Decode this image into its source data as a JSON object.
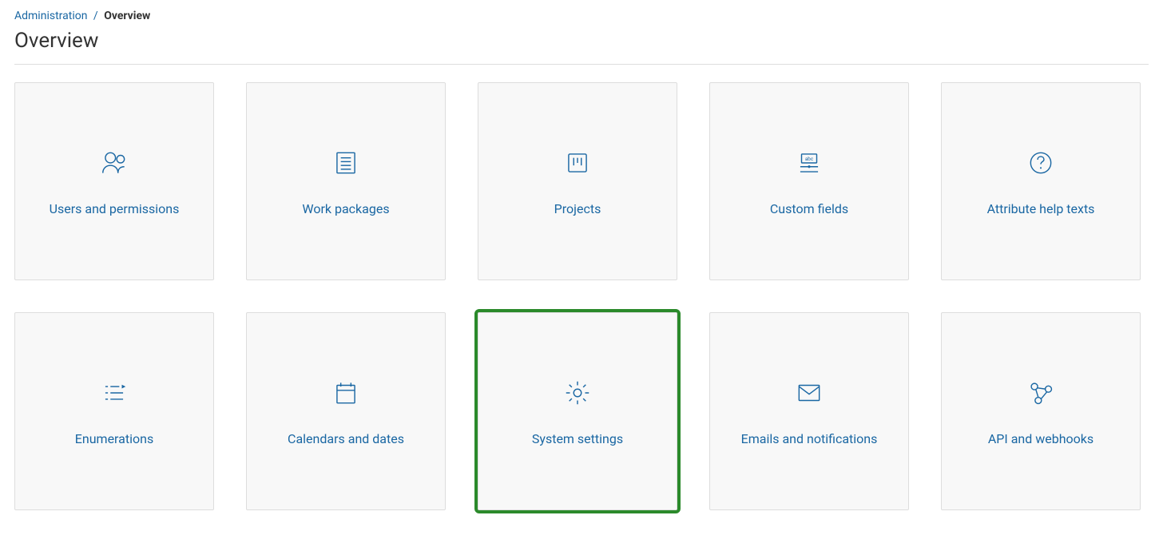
{
  "breadcrumb": {
    "parent": "Administration",
    "separator": "/",
    "current": "Overview"
  },
  "page_title": "Overview",
  "cards": [
    {
      "label": "Users and permissions",
      "icon": "users-icon",
      "highlighted": false
    },
    {
      "label": "Work packages",
      "icon": "document-icon",
      "highlighted": false
    },
    {
      "label": "Projects",
      "icon": "board-icon",
      "highlighted": false
    },
    {
      "label": "Custom fields",
      "icon": "custom-fields-icon",
      "highlighted": false
    },
    {
      "label": "Attribute help texts",
      "icon": "help-icon",
      "highlighted": false
    },
    {
      "label": "Enumerations",
      "icon": "list-icon",
      "highlighted": false
    },
    {
      "label": "Calendars and dates",
      "icon": "calendar-icon",
      "highlighted": false
    },
    {
      "label": "System settings",
      "icon": "gear-icon",
      "highlighted": true
    },
    {
      "label": "Emails and notifications",
      "icon": "mail-icon",
      "highlighted": false
    },
    {
      "label": "API and webhooks",
      "icon": "webhook-icon",
      "highlighted": false
    }
  ]
}
